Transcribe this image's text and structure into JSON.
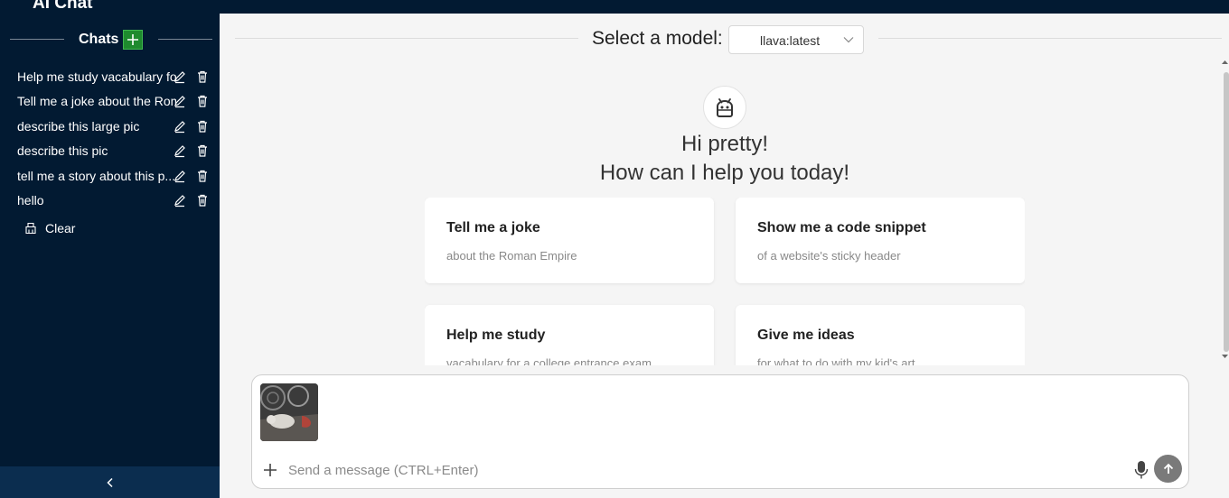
{
  "sidebar": {
    "app_title": "AI Chat",
    "chats_label": "Chats",
    "chats": [
      {
        "title": "Help me study vacabulary for"
      },
      {
        "title": "Tell me a joke about the Roman"
      },
      {
        "title": "describe this large pic"
      },
      {
        "title": "describe this pic"
      },
      {
        "title": "tell me a story about this p..."
      },
      {
        "title": "hello"
      }
    ],
    "clear_label": "Clear"
  },
  "model": {
    "label": "Select a model:",
    "selected": "llava:latest"
  },
  "greeting": {
    "line1": "Hi pretty!",
    "line2": "How can I help you today!"
  },
  "suggestions": [
    {
      "title": "Tell me a joke",
      "subtitle": "about the Roman Empire"
    },
    {
      "title": "Show me a code snippet",
      "subtitle": "of a website's sticky header"
    },
    {
      "title": "Help me study",
      "subtitle": "vacabulary for a college entrance exam"
    },
    {
      "title": "Give me ideas",
      "subtitle": "for what to do with my kid's art"
    }
  ],
  "composer": {
    "placeholder": "Send a message (CTRL+Enter)"
  },
  "colors": {
    "sidebar_bg": "#021a32",
    "new_chat_green": "#1e8a2e",
    "page_bg": "#f5f5f5"
  }
}
